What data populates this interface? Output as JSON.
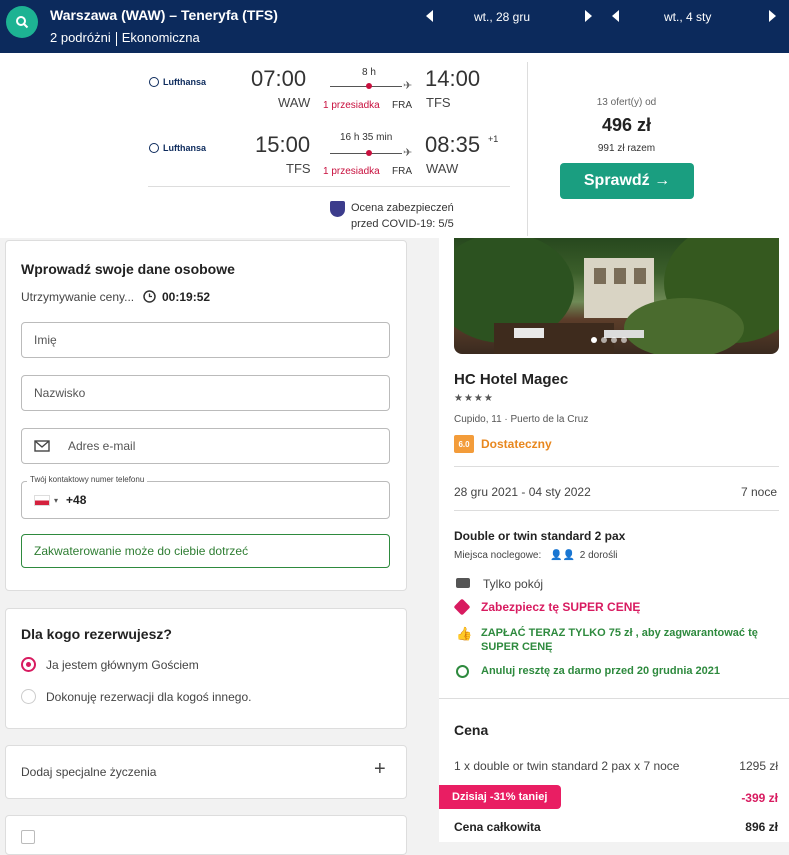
{
  "header": {
    "route": "Warszawa (WAW) – Teneryfa (TFS)",
    "travelers": "2 podróżni",
    "cabin": "Ekonomiczna",
    "depart_date": "wt., 28 gru",
    "return_date": "wt., 4 sty"
  },
  "flights": [
    {
      "airline": "Lufthansa",
      "dep_time": "07:00",
      "dep_code": "WAW",
      "duration": "8 h",
      "stops": "1 przesiadka",
      "via": "FRA",
      "arr_time": "14:00",
      "arr_code": "TFS",
      "day_offset": ""
    },
    {
      "airline": "Lufthansa",
      "dep_time": "15:00",
      "dep_code": "TFS",
      "duration": "16 h 35 min",
      "stops": "1 przesiadka",
      "via": "FRA",
      "arr_time": "08:35",
      "arr_code": "WAW",
      "day_offset": "+1"
    }
  ],
  "covid": {
    "line1": "Ocena zabezpieczeń",
    "line2": "przed COVID-19: 5/5"
  },
  "offer": {
    "count": "13 ofert(y) od",
    "price": "496 zł",
    "total": "991 zł razem",
    "cta": "Sprawdź →"
  },
  "form": {
    "title": "Wprowadź swoje dane osobowe",
    "hold_text": "Utrzymywanie ceny...",
    "timer": "00:19:52",
    "first_name_ph": "Imię",
    "last_name_ph": "Nazwisko",
    "email_ph": "Adres e-mail",
    "phone_label": "Twój kontaktowy numer telefonu",
    "phone_prefix": "+48",
    "notice": "Zakwaterowanie może do ciebie dotrzeć"
  },
  "booking_for": {
    "title": "Dla kogo rezerwujesz?",
    "option1": "Ja jestem głównym Gościem",
    "option2": "Dokonuję rezerwacji dla kogoś innego."
  },
  "special": {
    "label": "Dodaj specjalne życzenia",
    "plus": "+"
  },
  "hotel": {
    "name": "HC Hotel Magec",
    "stars": "★★★★",
    "address": "Cupido, 11 · Puerto de la Cruz",
    "score": "6.0",
    "score_label": "Dostateczny",
    "dates": "28 gru 2021 - 04 sty 2022",
    "nights": "7 noce",
    "room": "Double or twin standard 2 pax",
    "beds_label": "Miejsca noclegowe:",
    "beds_value": "2 dorośli",
    "board": "Tylko pokój",
    "tag": "Zabezpiecz tę SUPER CENĘ",
    "pay_now": "ZAPŁAĆ TERAZ TYLKO 75 zł , aby zagwarantować tę SUPER CENĘ",
    "cancel": "Anuluj resztę za darmo przed 20 grudnia 2021"
  },
  "pricing": {
    "title": "Cena",
    "line": "1 x double or twin standard 2 pax x 7 noce",
    "line_value": "1295 zł",
    "discount_label": "Dzisiaj -31% taniej",
    "discount_value": "-399 zł",
    "total_label": "Cena całkowita",
    "total_value": "896 zł"
  }
}
